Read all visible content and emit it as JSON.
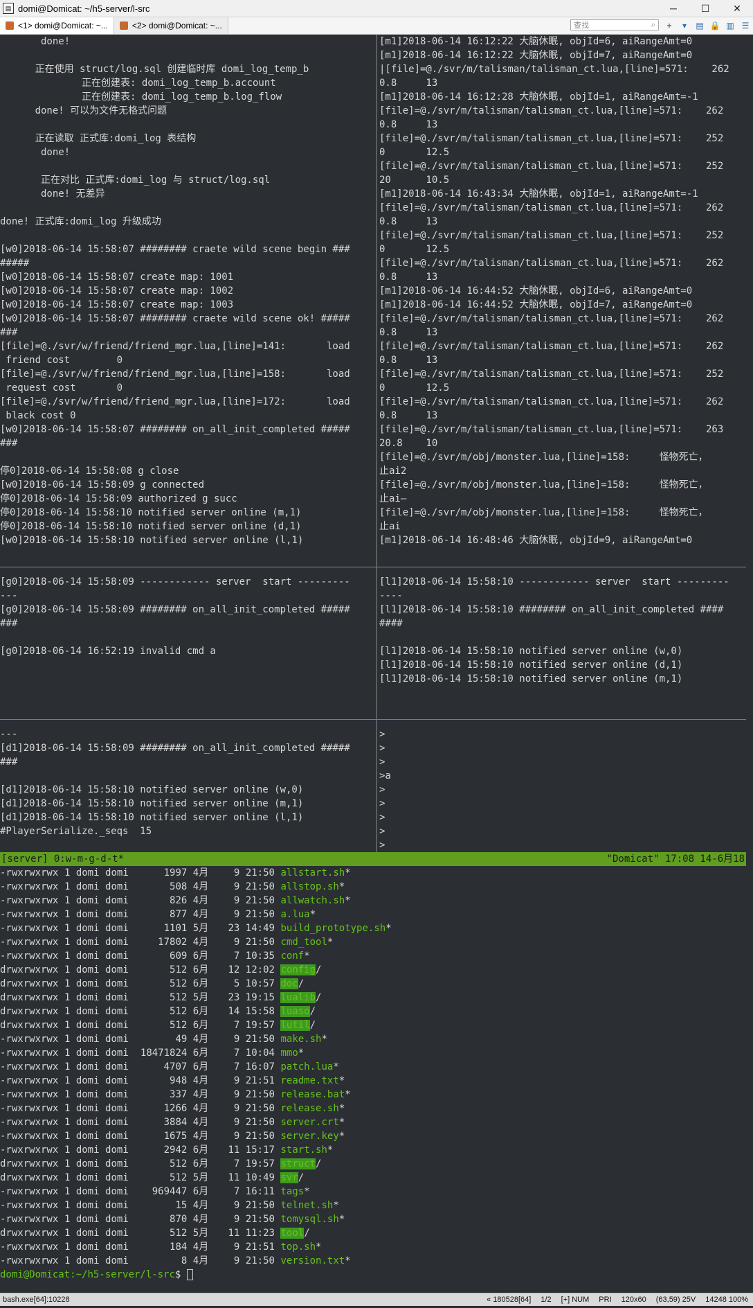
{
  "window": {
    "title": "domi@Domicat: ~/h5-server/l-src",
    "minimize": "─",
    "maximize": "☐",
    "close": "✕"
  },
  "tabs": [
    {
      "label": "<1> domi@Domicat: ~..."
    },
    {
      "label": "<2> domi@Domicat: ~..."
    }
  ],
  "toolbar": {
    "search_placeholder": "查找",
    "add": "+",
    "dropdown": "▾",
    "view": "▤",
    "lock": "🔒",
    "panel": "▥",
    "menu": "☰"
  },
  "panes": {
    "top_left": [
      "       done!",
      "",
      "      正在使用 struct/log.sql 创建临时库 domi_log_temp_b",
      "              正在创建表: domi_log_temp_b.account",
      "              正在创建表: domi_log_temp_b.log_flow",
      "      done! 可以为文件无格式问题",
      "",
      "      正在读取 正式库:domi_log 表结构",
      "       done!",
      "",
      "       正在对比 正式库:domi_log 与 struct/log.sql",
      "       done! 无差异",
      "",
      "done! 正式库:domi_log 升级成功",
      "",
      "[w0]2018-06-14 15:58:07 ######## craete wild scene begin ###",
      "#####",
      "[w0]2018-06-14 15:58:07 create map: 1001",
      "[w0]2018-06-14 15:58:07 create map: 1002",
      "[w0]2018-06-14 15:58:07 create map: 1003",
      "[w0]2018-06-14 15:58:07 ######## craete wild scene ok! #####",
      "###",
      "[file]=@./svr/w/friend/friend_mgr.lua,[line]=141:       load",
      " friend cost        0",
      "[file]=@./svr/w/friend/friend_mgr.lua,[line]=158:       load",
      " request cost       0",
      "[file]=@./svr/w/friend/friend_mgr.lua,[line]=172:       load",
      " black cost 0",
      "[w0]2018-06-14 15:58:07 ######## on_all_init_completed #####",
      "###",
      "",
      "停0]2018-06-14 15:58:08 g close",
      "[w0]2018-06-14 15:58:09 g connected",
      "停0]2018-06-14 15:58:09 authorized g succ",
      "停0]2018-06-14 15:58:10 notified server online (m,1)",
      "停0]2018-06-14 15:58:10 notified server online (d,1)",
      "[w0]2018-06-14 15:58:10 notified server online (l,1)"
    ],
    "top_right": [
      "[m1]2018-06-14 16:12:22 大脑休眠, objId=6, aiRangeAmt=0",
      "[m1]2018-06-14 16:12:22 大脑休眠, objId=7, aiRangeAmt=0",
      "|[file]=@./svr/m/talisman/talisman_ct.lua,[line]=571:    262",
      "0.8     13",
      "[m1]2018-06-14 16:12:28 大脑休眠, objId=1, aiRangeAmt=-1",
      "[file]=@./svr/m/talisman/talisman_ct.lua,[line]=571:    262",
      "0.8     13",
      "[file]=@./svr/m/talisman/talisman_ct.lua,[line]=571:    252",
      "0       12.5",
      "[file]=@./svr/m/talisman/talisman_ct.lua,[line]=571:    252",
      "20      10.5",
      "[m1]2018-06-14 16:43:34 大脑休眠, objId=1, aiRangeAmt=-1",
      "[file]=@./svr/m/talisman/talisman_ct.lua,[line]=571:    262",
      "0.8     13",
      "[file]=@./svr/m/talisman/talisman_ct.lua,[line]=571:    252",
      "0       12.5",
      "[file]=@./svr/m/talisman/talisman_ct.lua,[line]=571:    262",
      "0.8     13",
      "[m1]2018-06-14 16:44:52 大脑休眠, objId=6, aiRangeAmt=0",
      "[m1]2018-06-14 16:44:52 大脑休眠, objId=7, aiRangeAmt=0",
      "[file]=@./svr/m/talisman/talisman_ct.lua,[line]=571:    262",
      "0.8     13",
      "[file]=@./svr/m/talisman/talisman_ct.lua,[line]=571:    262",
      "0.8     13",
      "[file]=@./svr/m/talisman/talisman_ct.lua,[line]=571:    252",
      "0       12.5",
      "[file]=@./svr/m/talisman/talisman_ct.lua,[line]=571:    262",
      "0.8     13",
      "[file]=@./svr/m/talisman/talisman_ct.lua,[line]=571:    263",
      "20.8    10",
      "[file]=@./svr/m/obj/monster.lua,[line]=158:     怪物死亡，",
      "止ai2",
      "[file]=@./svr/m/obj/monster.lua,[line]=158:     怪物死亡，",
      "止ai—",
      "[file]=@./svr/m/obj/monster.lua,[line]=158:     怪物死亡，",
      "止ai",
      "[m1]2018-06-14 16:48:46 大脑休眠, objId=9, aiRangeAmt=0"
    ],
    "mid_left": [
      "[g0]2018-06-14 15:58:09 ------------ server  start ---------",
      "---",
      "[g0]2018-06-14 15:58:09 ######## on_all_init_completed #####",
      "###",
      "",
      "[g0]2018-06-14 16:52:19 invalid cmd a"
    ],
    "mid_right": [
      "[l1]2018-06-14 15:58:10 ------------ server  start ---------",
      "----",
      "[l1]2018-06-14 15:58:10 ######## on_all_init_completed ####",
      "####",
      "",
      "[l1]2018-06-14 15:58:10 notified server online (w,0)",
      "[l1]2018-06-14 15:58:10 notified server online (d,1)",
      "[l1]2018-06-14 15:58:10 notified server online (m,1)"
    ],
    "low_left": [
      "---",
      "[d1]2018-06-14 15:58:09 ######## on_all_init_completed #####",
      "###",
      "",
      "[d1]2018-06-14 15:58:10 notified server online (w,0)",
      "[d1]2018-06-14 15:58:10 notified server online (m,1)",
      "[d1]2018-06-14 15:58:10 notified server online (l,1)",
      "#PlayerSerialize._seqs  15"
    ],
    "low_right": [
      ">",
      ">",
      ">",
      ">a",
      ">",
      ">",
      ">",
      ">",
      ">"
    ]
  },
  "tmux_status": {
    "left": "[server] 0:w-m-g-d-t*",
    "right": "\"Domicat\" 17:08 14-6月18"
  },
  "listing": [
    {
      "perm": "-rwxrwxrwx",
      "links": "1",
      "owner": "domi",
      "group": "domi",
      "size": "1997",
      "month": "4月",
      "day": "9",
      "time": "21:50",
      "name": "allstart.sh",
      "suffix": "*",
      "kind": "exec"
    },
    {
      "perm": "-rwxrwxrwx",
      "links": "1",
      "owner": "domi",
      "group": "domi",
      "size": "508",
      "month": "4月",
      "day": "9",
      "time": "21:50",
      "name": "allstop.sh",
      "suffix": "*",
      "kind": "exec"
    },
    {
      "perm": "-rwxrwxrwx",
      "links": "1",
      "owner": "domi",
      "group": "domi",
      "size": "826",
      "month": "4月",
      "day": "9",
      "time": "21:50",
      "name": "allwatch.sh",
      "suffix": "*",
      "kind": "exec"
    },
    {
      "perm": "-rwxrwxrwx",
      "links": "1",
      "owner": "domi",
      "group": "domi",
      "size": "877",
      "month": "4月",
      "day": "9",
      "time": "21:50",
      "name": "a.lua",
      "suffix": "*",
      "kind": "exec"
    },
    {
      "perm": "-rwxrwxrwx",
      "links": "1",
      "owner": "domi",
      "group": "domi",
      "size": "1101",
      "month": "5月",
      "day": "23",
      "time": "14:49",
      "name": "build_prototype.sh",
      "suffix": "*",
      "kind": "exec"
    },
    {
      "perm": "-rwxrwxrwx",
      "links": "1",
      "owner": "domi",
      "group": "domi",
      "size": "17802",
      "month": "4月",
      "day": "9",
      "time": "21:50",
      "name": "cmd_tool",
      "suffix": "*",
      "kind": "exec"
    },
    {
      "perm": "-rwxrwxrwx",
      "links": "1",
      "owner": "domi",
      "group": "domi",
      "size": "609",
      "month": "6月",
      "day": "7",
      "time": "10:35",
      "name": "conf",
      "suffix": "*",
      "kind": "exec"
    },
    {
      "perm": "drwxrwxrwx",
      "links": "1",
      "owner": "domi",
      "group": "domi",
      "size": "512",
      "month": "6月",
      "day": "12",
      "time": "12:02",
      "name": "config",
      "suffix": "/",
      "kind": "dir"
    },
    {
      "perm": "drwxrwxrwx",
      "links": "1",
      "owner": "domi",
      "group": "domi",
      "size": "512",
      "month": "6月",
      "day": "5",
      "time": "10:57",
      "name": "doc",
      "suffix": "/",
      "kind": "dir"
    },
    {
      "perm": "drwxrwxrwx",
      "links": "1",
      "owner": "domi",
      "group": "domi",
      "size": "512",
      "month": "5月",
      "day": "23",
      "time": "19:15",
      "name": "lualib",
      "suffix": "/",
      "kind": "dir"
    },
    {
      "perm": "drwxrwxrwx",
      "links": "1",
      "owner": "domi",
      "group": "domi",
      "size": "512",
      "month": "6月",
      "day": "14",
      "time": "15:58",
      "name": "luaso",
      "suffix": "/",
      "kind": "dir"
    },
    {
      "perm": "drwxrwxrwx",
      "links": "1",
      "owner": "domi",
      "group": "domi",
      "size": "512",
      "month": "6月",
      "day": "7",
      "time": "19:57",
      "name": "lutil",
      "suffix": "/",
      "kind": "dir"
    },
    {
      "perm": "-rwxrwxrwx",
      "links": "1",
      "owner": "domi",
      "group": "domi",
      "size": "49",
      "month": "4月",
      "day": "9",
      "time": "21:50",
      "name": "make.sh",
      "suffix": "*",
      "kind": "exec"
    },
    {
      "perm": "-rwxrwxrwx",
      "links": "1",
      "owner": "domi",
      "group": "domi",
      "size": "18471824",
      "month": "6月",
      "day": "7",
      "time": "10:04",
      "name": "mmo",
      "suffix": "*",
      "kind": "exec"
    },
    {
      "perm": "-rwxrwxrwx",
      "links": "1",
      "owner": "domi",
      "group": "domi",
      "size": "4707",
      "month": "6月",
      "day": "7",
      "time": "16:07",
      "name": "patch.lua",
      "suffix": "*",
      "kind": "exec"
    },
    {
      "perm": "-rwxrwxrwx",
      "links": "1",
      "owner": "domi",
      "group": "domi",
      "size": "948",
      "month": "4月",
      "day": "9",
      "time": "21:51",
      "name": "readme.txt",
      "suffix": "*",
      "kind": "exec"
    },
    {
      "perm": "-rwxrwxrwx",
      "links": "1",
      "owner": "domi",
      "group": "domi",
      "size": "337",
      "month": "4月",
      "day": "9",
      "time": "21:50",
      "name": "release.bat",
      "suffix": "*",
      "kind": "exec"
    },
    {
      "perm": "-rwxrwxrwx",
      "links": "1",
      "owner": "domi",
      "group": "domi",
      "size": "1266",
      "month": "4月",
      "day": "9",
      "time": "21:50",
      "name": "release.sh",
      "suffix": "*",
      "kind": "exec"
    },
    {
      "perm": "-rwxrwxrwx",
      "links": "1",
      "owner": "domi",
      "group": "domi",
      "size": "3884",
      "month": "4月",
      "day": "9",
      "time": "21:50",
      "name": "server.crt",
      "suffix": "*",
      "kind": "exec"
    },
    {
      "perm": "-rwxrwxrwx",
      "links": "1",
      "owner": "domi",
      "group": "domi",
      "size": "1675",
      "month": "4月",
      "day": "9",
      "time": "21:50",
      "name": "server.key",
      "suffix": "*",
      "kind": "exec"
    },
    {
      "perm": "-rwxrwxrwx",
      "links": "1",
      "owner": "domi",
      "group": "domi",
      "size": "2942",
      "month": "6月",
      "day": "11",
      "time": "15:17",
      "name": "start.sh",
      "suffix": "*",
      "kind": "exec"
    },
    {
      "perm": "drwxrwxrwx",
      "links": "1",
      "owner": "domi",
      "group": "domi",
      "size": "512",
      "month": "6月",
      "day": "7",
      "time": "19:57",
      "name": "struct",
      "suffix": "/",
      "kind": "dir"
    },
    {
      "perm": "drwxrwxrwx",
      "links": "1",
      "owner": "domi",
      "group": "domi",
      "size": "512",
      "month": "5月",
      "day": "11",
      "time": "10:49",
      "name": "svr",
      "suffix": "/",
      "kind": "dir"
    },
    {
      "perm": "-rwxrwxrwx",
      "links": "1",
      "owner": "domi",
      "group": "domi",
      "size": "969447",
      "month": "6月",
      "day": "7",
      "time": "16:11",
      "name": "tags",
      "suffix": "*",
      "kind": "exec"
    },
    {
      "perm": "-rwxrwxrwx",
      "links": "1",
      "owner": "domi",
      "group": "domi",
      "size": "15",
      "month": "4月",
      "day": "9",
      "time": "21:50",
      "name": "telnet.sh",
      "suffix": "*",
      "kind": "exec"
    },
    {
      "perm": "-rwxrwxrwx",
      "links": "1",
      "owner": "domi",
      "group": "domi",
      "size": "870",
      "month": "4月",
      "day": "9",
      "time": "21:50",
      "name": "tomysql.sh",
      "suffix": "*",
      "kind": "exec"
    },
    {
      "perm": "drwxrwxrwx",
      "links": "1",
      "owner": "domi",
      "group": "domi",
      "size": "512",
      "month": "5月",
      "day": "11",
      "time": "11:23",
      "name": "tool",
      "suffix": "/",
      "kind": "dir"
    },
    {
      "perm": "-rwxrwxrwx",
      "links": "1",
      "owner": "domi",
      "group": "domi",
      "size": "184",
      "month": "4月",
      "day": "9",
      "time": "21:51",
      "name": "top.sh",
      "suffix": "*",
      "kind": "exec"
    },
    {
      "perm": "-rwxrwxrwx",
      "links": "1",
      "owner": "domi",
      "group": "domi",
      "size": "8",
      "month": "4月",
      "day": "9",
      "time": "21:50",
      "name": "version.txt",
      "suffix": "*",
      "kind": "exec"
    }
  ],
  "prompt": {
    "user_host": "domi@Domicat",
    "path": ":~/h5-server/l-src",
    "symbol": "$ "
  },
  "statusbar": {
    "process": "bash.exe[64]:10228",
    "items": [
      "« 180528[64]",
      "1/2",
      "[+] NUM",
      "PRI",
      "120x60",
      "(63,59) 25V",
      "14248 100%"
    ]
  },
  "colors": {
    "background": "#2b2f33",
    "foreground": "#d6d6d6",
    "accent_green": "#66c21c",
    "status_green": "#5f9e1f"
  }
}
